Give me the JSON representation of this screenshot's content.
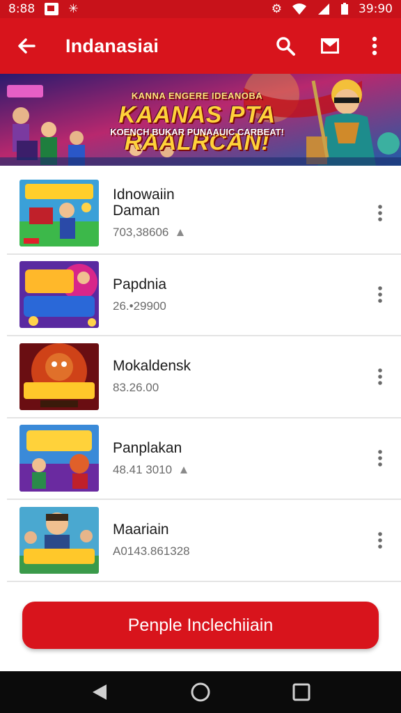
{
  "status_bar": {
    "left_text": "8:88",
    "time": "39:90"
  },
  "app_bar": {
    "title": "Indanasiai",
    "icons": [
      "back-arrow-icon",
      "search-icon",
      "mail-icon",
      "more-vert-icon"
    ]
  },
  "banner": {
    "subtitle": "KANNA ENGERE IDEANOBA",
    "title": "KAANAS PTA RAALRCAN!",
    "tagline": "KOENCH BUKAR PUNAAUIC CARBEAT!"
  },
  "list": {
    "items": [
      {
        "title": "Idnowaiin",
        "title2": "Daman",
        "subtitle": "703,38606",
        "thumb": "game-art-red-tiles"
      },
      {
        "title": "Papdnia",
        "title2": "",
        "subtitle": "26.•29900",
        "thumb": "game-art-b9-sanrais"
      },
      {
        "title": "Mokaldensk",
        "title2": "",
        "subtitle": "83.26.00",
        "thumb": "game-art-eramyaa"
      },
      {
        "title": "Panplakan",
        "title2": "",
        "subtitle": "48.41 3010",
        "thumb": "game-art-panimnis"
      },
      {
        "title": "Maariain",
        "title2": "",
        "subtitle": "A0143.861328",
        "thumb": "game-art-clanoria"
      }
    ]
  },
  "cta": {
    "label": "Penple Inclechiiain"
  },
  "nav": {
    "icons": [
      "back-triangle-icon",
      "home-circle-icon",
      "recents-square-icon"
    ]
  },
  "colors": {
    "primary_red": "#d8141c",
    "status_red": "#c8121a",
    "divider": "#e4e4e4"
  }
}
